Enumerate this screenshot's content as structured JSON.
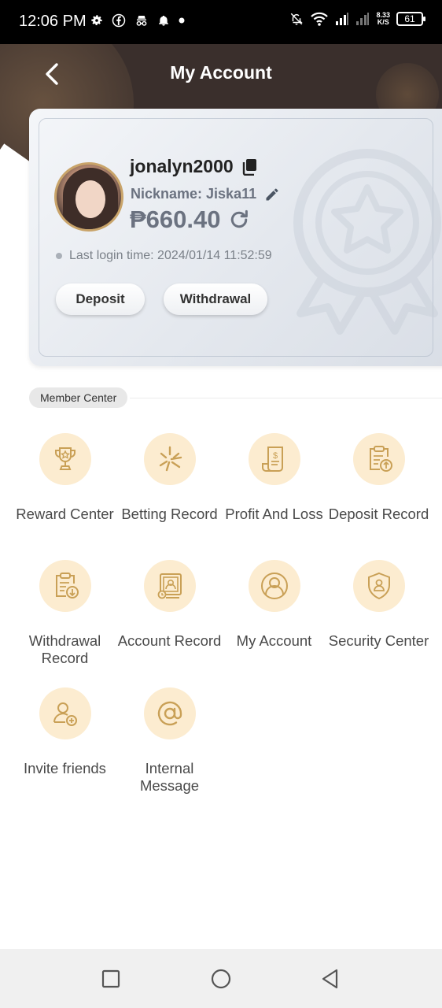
{
  "status_bar": {
    "time": "12:06 PM",
    "net_speed_value": "8.33",
    "net_speed_unit": "K/S",
    "battery": "61",
    "left_icons": [
      "gear-icon",
      "facebook-icon",
      "incognito-icon",
      "bell-icon",
      "dot-icon"
    ],
    "right_icons": [
      "bell-off-icon",
      "wifi-icon",
      "signal-icon",
      "signal-icon",
      "battery-icon"
    ]
  },
  "header": {
    "title": "My Account",
    "background_color": "#3a2f2c"
  },
  "profile": {
    "username": "jonalyn2000",
    "nickname": "Nickname: Jiska11",
    "balance": "₱660.40",
    "last_login": "Last login time: 2024/01/14 11:52:59",
    "deposit_label": "Deposit",
    "withdraw_label": "Withdrawal"
  },
  "member_center": {
    "title": "Member Center",
    "accent_color": "#fcecd0",
    "icon_color": "#c9a056",
    "items": [
      {
        "label": "Reward Center",
        "icon": "trophy-icon"
      },
      {
        "label": "Betting Record",
        "icon": "betting-icon"
      },
      {
        "label": "Profit And Loss",
        "icon": "receipt-icon"
      },
      {
        "label": "Deposit Record",
        "icon": "deposit-record-icon"
      },
      {
        "label": "Withdrawal Record",
        "icon": "withdrawal-record-icon"
      },
      {
        "label": "Account Record",
        "icon": "account-record-icon"
      },
      {
        "label": "My Account",
        "icon": "user-icon"
      },
      {
        "label": "Security Center",
        "icon": "shield-icon"
      },
      {
        "label": "Invite friends",
        "icon": "invite-icon"
      },
      {
        "label": "Internal Message",
        "icon": "at-icon"
      }
    ]
  },
  "nav_bar": {
    "buttons": [
      "recents-icon",
      "home-icon",
      "back-icon"
    ]
  }
}
